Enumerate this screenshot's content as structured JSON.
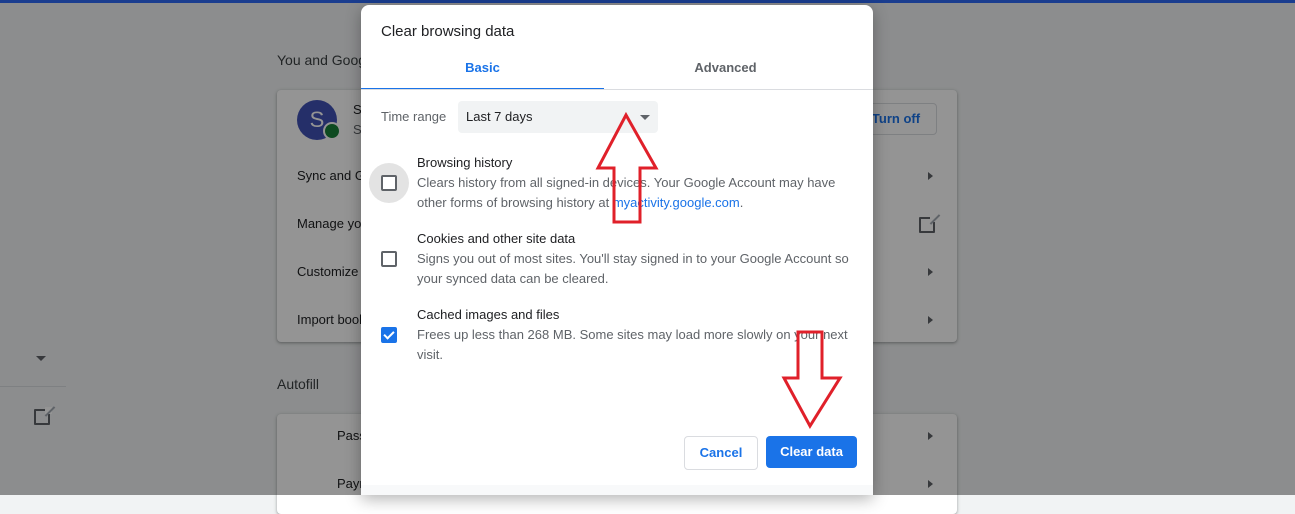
{
  "background": {
    "section_you_and_google": "You and Google",
    "account_initial": "S",
    "account_name_trunc": "S",
    "account_email_trunc": "S",
    "turn_off_label": "Turn off",
    "rows": [
      "Sync and Google services",
      "Manage your Google Account",
      "Customize your Chrome name and picture",
      "Import bookmarks and settings"
    ],
    "section_autofill": "Autofill",
    "autofill_rows": [
      "Passwords",
      "Payment methods"
    ]
  },
  "dialog": {
    "title": "Clear browsing data",
    "tabs": {
      "basic": "Basic",
      "advanced": "Advanced"
    },
    "time_range_label": "Time range",
    "time_range_value": "Last 7 days",
    "options": [
      {
        "title": "Browsing history",
        "desc_prefix": "Clears history from all signed-in devices. Your Google Account may have other forms of browsing history at ",
        "desc_link": "myactivity.google.com",
        "desc_suffix": ".",
        "checked": false
      },
      {
        "title": "Cookies and other site data",
        "desc": "Signs you out of most sites. You'll stay signed in to your Google Account so your synced data can be cleared.",
        "checked": false
      },
      {
        "title": "Cached images and files",
        "desc": "Frees up less than 268 MB. Some sites may load more slowly on your next visit.",
        "checked": true
      }
    ],
    "cancel_label": "Cancel",
    "clear_label": "Clear data"
  },
  "colors": {
    "accent": "#1a73e8",
    "annotation_arrow": "#e0202a"
  }
}
